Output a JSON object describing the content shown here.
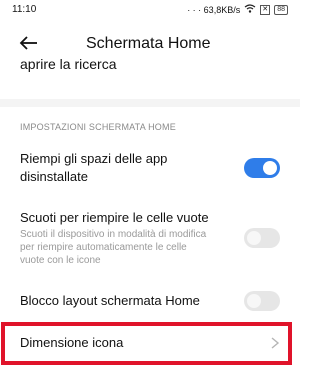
{
  "status": {
    "time": "11:10",
    "network": "· · · 63,8KB/s",
    "battery": "88"
  },
  "header": {
    "title": "Schermata Home"
  },
  "previous": {
    "partial_text": "aprire la ricerca"
  },
  "section": {
    "header": "IMPOSTAZIONI SCHERMATA HOME"
  },
  "settings": [
    {
      "title_line1": "Riempi gli spazi delle app",
      "title_line2": "disinstallate",
      "enabled": true
    },
    {
      "title": "Scuoti per riempire le celle vuote",
      "sub_line1": "Scuoti il dispositivo in modalità di modifica",
      "sub_line2": "per riempire automaticamente le celle",
      "sub_line3": "vuote con le icone",
      "enabled": false
    },
    {
      "title": "Blocco layout schermata Home",
      "enabled": false
    }
  ],
  "nav": {
    "label": "Dimensione icona"
  },
  "colors": {
    "accent": "#2f7de9",
    "highlight": "#e0132a"
  }
}
